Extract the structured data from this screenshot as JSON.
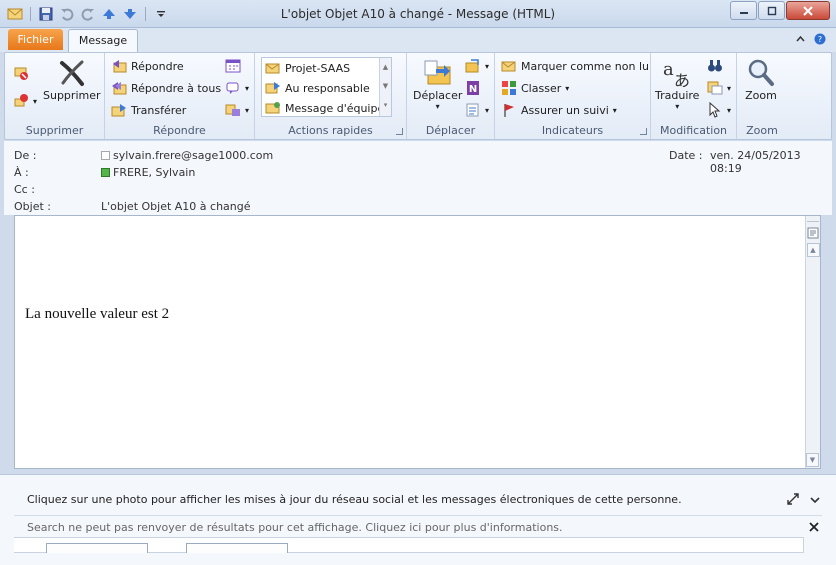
{
  "window": {
    "title": "L'objet Objet A10 à changé  -  Message (HTML)"
  },
  "quick_access": {
    "icons": [
      "outlook-envelope-icon",
      "save-icon",
      "undo-icon",
      "redo-icon",
      "up-arrow-icon",
      "down-arrow-icon",
      "customize-icon"
    ]
  },
  "tabs": {
    "file": "Fichier",
    "message": "Message"
  },
  "ribbon": {
    "groups": {
      "supprimer": "Supprimer",
      "repondre": "Répondre",
      "actions_rapides": "Actions rapides",
      "deplacer": "Déplacer",
      "indicateurs": "Indicateurs",
      "modification": "Modification",
      "zoom": "Zoom"
    },
    "delete_label": "Supprimer",
    "reply": "Répondre",
    "reply_all": "Répondre à tous",
    "forward": "Transférer",
    "quick_steps": [
      "Projet-SAAS",
      "Au responsable",
      "Message d'équipe"
    ],
    "move_label": "Déplacer",
    "mark_unread": "Marquer comme non lu",
    "categorize": "Classer",
    "follow_up": "Assurer un suivi",
    "translate_label": "Traduire",
    "zoom_label": "Zoom"
  },
  "header": {
    "from_label": "De :",
    "from_value": "sylvain.frere@sage1000.com",
    "to_label": "À :",
    "to_value": "FRERE, Sylvain",
    "cc_label": "Cc :",
    "subject_label": "Objet :",
    "subject_value": "L'objet Objet A10 à changé",
    "date_label": "Date :",
    "date_value": "ven. 24/05/2013 08:19"
  },
  "body": {
    "text": "La nouvelle valeur est 2"
  },
  "social": {
    "photo_hint": "Cliquez sur une photo pour afficher les mises à jour du réseau social et les messages électroniques de cette personne.",
    "search_notice": "Search ne peut pas renvoyer de résultats pour cet affichage. Cliquez ici pour plus d'informations."
  },
  "colors": {
    "file_tab": "#e8781a",
    "ribbon_bg": "#e3ebf6",
    "close_button": "#c94a3a"
  }
}
